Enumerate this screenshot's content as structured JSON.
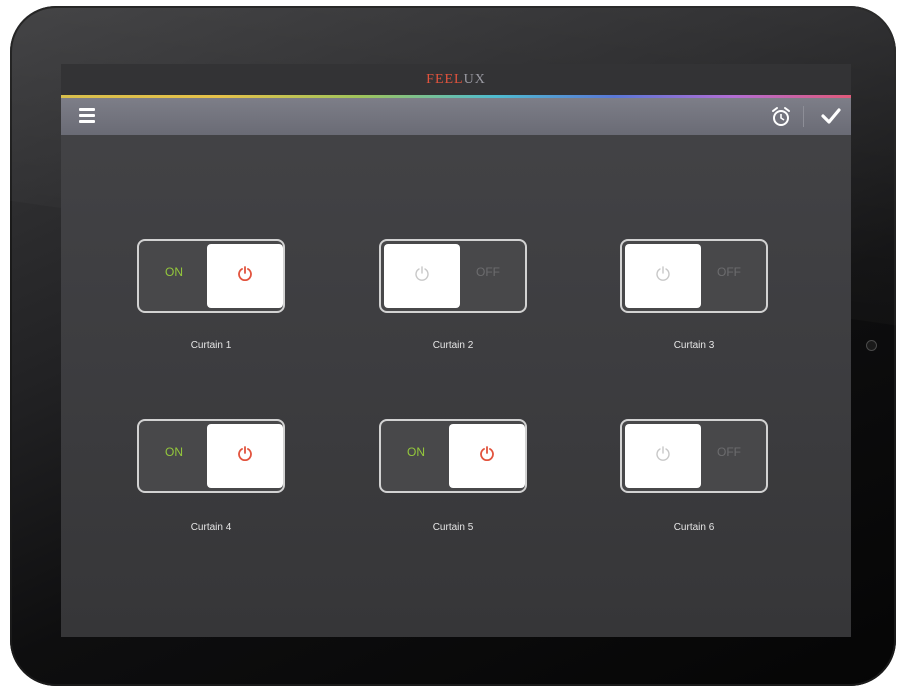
{
  "app": {
    "logo_part1": "FEEL",
    "logo_part2": "UX"
  },
  "colors": {
    "on_text": "#94c83c",
    "power_on": "#e2533d",
    "power_off": "#c8c8c8",
    "off_text": "#6c6c6e"
  },
  "toolbar": {
    "menu_icon": "menu-icon",
    "alarm_icon": "alarm-clock-icon",
    "confirm_icon": "checkmark-icon"
  },
  "curtains": [
    {
      "name": "Curtain 1",
      "state_label": "ON",
      "state": "on"
    },
    {
      "name": "Curtain 2",
      "state_label": "OFF",
      "state": "off"
    },
    {
      "name": "Curtain 3",
      "state_label": "OFF",
      "state": "off"
    },
    {
      "name": "Curtain 4",
      "state_label": "ON",
      "state": "on"
    },
    {
      "name": "Curtain 5",
      "state_label": "ON",
      "state": "on"
    },
    {
      "name": "Curtain 6",
      "state_label": "OFF",
      "state": "off"
    }
  ]
}
